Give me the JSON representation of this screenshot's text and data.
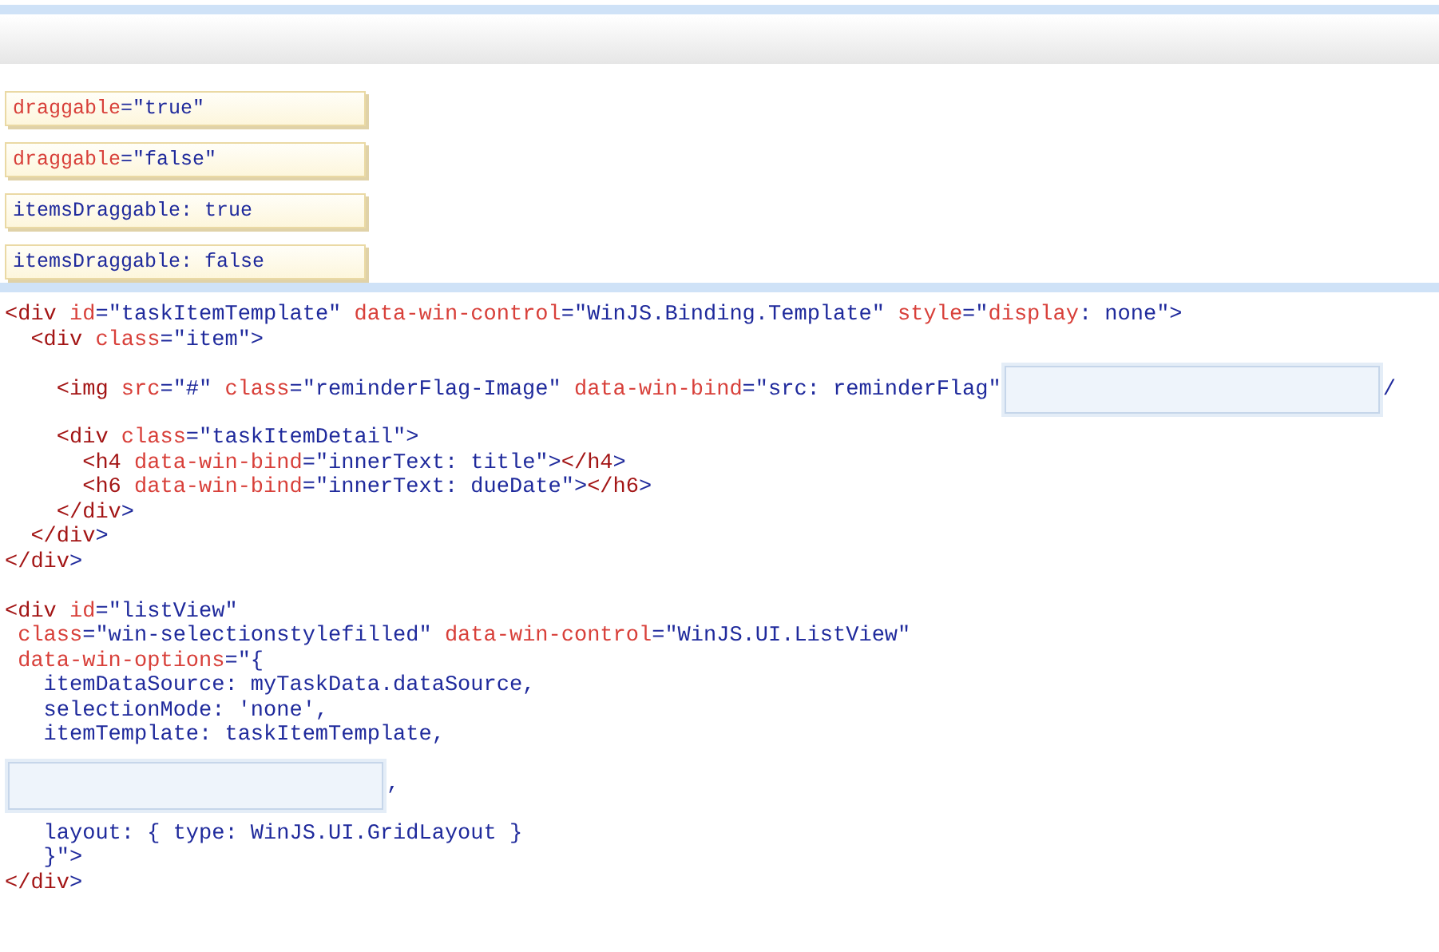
{
  "tiles": [
    {
      "tokens": [
        {
          "kind": "attr",
          "text": "draggable"
        },
        {
          "kind": "val",
          "text": "=\"true\""
        }
      ]
    },
    {
      "tokens": [
        {
          "kind": "attr",
          "text": "draggable"
        },
        {
          "kind": "val",
          "text": "=\"false\""
        }
      ]
    },
    {
      "tokens": [
        {
          "kind": "val",
          "text": "itemsDraggable: true"
        }
      ]
    },
    {
      "tokens": [
        {
          "kind": "val",
          "text": "itemsDraggable: false"
        }
      ]
    }
  ],
  "code_lines": [
    {
      "kind": "code",
      "tokens": [
        {
          "kind": "tag",
          "text": "<div"
        },
        {
          "kind": "attr",
          "text": " id"
        },
        {
          "kind": "val",
          "text": "=\"taskItemTemplate\""
        },
        {
          "kind": "attr",
          "text": " data-win-control"
        },
        {
          "kind": "val",
          "text": "=\"WinJS.Binding.Template\""
        },
        {
          "kind": "attr",
          "text": " style"
        },
        {
          "kind": "val",
          "text": "=\""
        },
        {
          "kind": "attr",
          "text": "display"
        },
        {
          "kind": "val",
          "text": ": none\">"
        }
      ]
    },
    {
      "kind": "code",
      "tokens": [
        {
          "kind": "tag",
          "text": "  <div"
        },
        {
          "kind": "attr",
          "text": " class"
        },
        {
          "kind": "val",
          "text": "=\"item\">"
        }
      ]
    },
    {
      "kind": "code",
      "tokens": [
        {
          "kind": "tag",
          "text": "    <img"
        },
        {
          "kind": "attr",
          "text": " src"
        },
        {
          "kind": "val",
          "text": "=\"#\""
        },
        {
          "kind": "attr",
          "text": " class"
        },
        {
          "kind": "val",
          "text": "=\"reminderFlag-Image\""
        },
        {
          "kind": "attr",
          "text": " data-win-bind"
        },
        {
          "kind": "val",
          "text": "=\"src: reminderFlag\""
        },
        {
          "kind": "field"
        },
        {
          "kind": "val",
          "text": "/"
        }
      ]
    },
    {
      "kind": "code",
      "tokens": [
        {
          "kind": "tag",
          "text": "    <div"
        },
        {
          "kind": "attr",
          "text": " class"
        },
        {
          "kind": "val",
          "text": "=\"taskItemDetail\">"
        }
      ]
    },
    {
      "kind": "code",
      "tokens": [
        {
          "kind": "tag",
          "text": "      <h4"
        },
        {
          "kind": "attr",
          "text": " data-win-bind"
        },
        {
          "kind": "val",
          "text": "=\"innerText: title\">"
        },
        {
          "kind": "tag",
          "text": "</h4"
        },
        {
          "kind": "val",
          "text": ">"
        }
      ]
    },
    {
      "kind": "code",
      "tokens": [
        {
          "kind": "tag",
          "text": "      <h6"
        },
        {
          "kind": "attr",
          "text": " data-win-bind"
        },
        {
          "kind": "val",
          "text": "=\"innerText: dueDate\">"
        },
        {
          "kind": "tag",
          "text": "</h6"
        },
        {
          "kind": "val",
          "text": ">"
        }
      ]
    },
    {
      "kind": "code",
      "tokens": [
        {
          "kind": "tag",
          "text": "    </div"
        },
        {
          "kind": "val",
          "text": ">"
        }
      ]
    },
    {
      "kind": "code",
      "tokens": [
        {
          "kind": "tag",
          "text": "  </div"
        },
        {
          "kind": "val",
          "text": ">"
        }
      ]
    },
    {
      "kind": "code",
      "tokens": [
        {
          "kind": "tag",
          "text": "</div"
        },
        {
          "kind": "val",
          "text": ">"
        }
      ]
    },
    {
      "kind": "gap"
    },
    {
      "kind": "code",
      "tokens": [
        {
          "kind": "tag",
          "text": "<div"
        },
        {
          "kind": "attr",
          "text": " id"
        },
        {
          "kind": "val",
          "text": "=\"listView\""
        }
      ]
    },
    {
      "kind": "code",
      "tokens": [
        {
          "kind": "attr",
          "text": " class"
        },
        {
          "kind": "val",
          "text": "=\"win-selectionstylefilled\""
        },
        {
          "kind": "attr",
          "text": " data-win-control"
        },
        {
          "kind": "val",
          "text": "=\"WinJS.UI.ListView\""
        }
      ]
    },
    {
      "kind": "code",
      "tokens": [
        {
          "kind": "attr",
          "text": " data-win-options"
        },
        {
          "kind": "val",
          "text": "=\"{"
        }
      ]
    },
    {
      "kind": "code",
      "tokens": [
        {
          "kind": "val",
          "text": "   itemDataSource: myTaskData.dataSource,"
        }
      ]
    },
    {
      "kind": "code",
      "tokens": [
        {
          "kind": "val",
          "text": "   selectionMode: 'none',"
        }
      ]
    },
    {
      "kind": "code",
      "tokens": [
        {
          "kind": "val",
          "text": "   itemTemplate: taskItemTemplate,"
        }
      ]
    },
    {
      "kind": "code",
      "tokens": [
        {
          "kind": "field"
        },
        {
          "kind": "val",
          "text": ","
        }
      ]
    },
    {
      "kind": "code",
      "tokens": [
        {
          "kind": "val",
          "text": "   layout: { type: WinJS.UI.GridLayout }"
        }
      ]
    },
    {
      "kind": "code",
      "tokens": [
        {
          "kind": "val",
          "text": "   }\">"
        }
      ]
    },
    {
      "kind": "code",
      "tokens": [
        {
          "kind": "tag",
          "text": "</div"
        },
        {
          "kind": "val",
          "text": ">"
        }
      ]
    }
  ]
}
